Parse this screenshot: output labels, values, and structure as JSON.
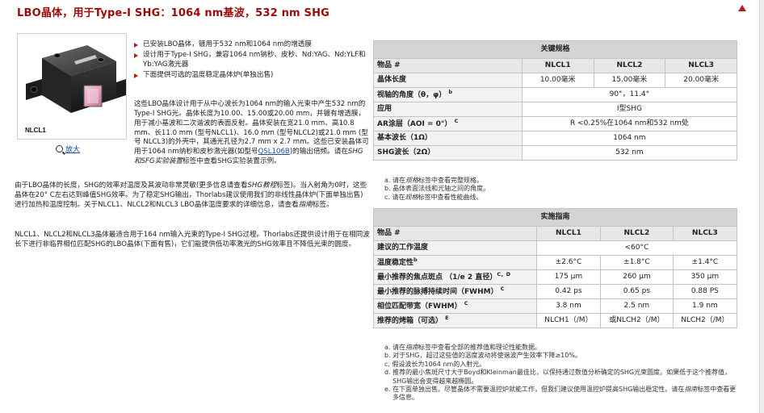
{
  "page": {
    "title": "LBO晶体，用于Type-I SHG：1064 nm基波，532 nm SHG"
  },
  "product_image": {
    "label": "NLCL1",
    "zoom_link": "放大"
  },
  "bullets": [
    "已安装LBO晶体，镀用于532 nm和1064 nm的增透膜",
    "设计用于Type-I SHG，兼容1064 nm钠秒、皮秒、Nd:YAG、Nd:YLF和Yb:YAG激光器",
    "下面提供可选的温度稳定晶体炉(单独出售)"
  ],
  "paragraphs": {
    "p1": {
      "before": "这些LBO晶体设计用于从中心波长为1064 nm的输入光束中产生532 nm的Type-I SHG光。晶体长度为10.00、15.00或20.00 mm，并镀有增透膜，用于减小基波和二次谐波的表面反射。晶体安装在宽21.0 mm、高10.8 mm、长11.0 mm (型号NLCL1)、16.0 mm (型号NLCL2)或21.0 mm (型号 NLCL3)的外壳中，其通光孔径为2.7 mm x 2.7 mm。这些已安装晶体可用于1064 nm纳秒和皮秒激光器(如型号",
      "link": "QSL106B",
      "mid": ")的输出倍频。请在",
      "italic": "SHG和SFG实验装置",
      "after": "标签中查看SHG实验装置示例。"
    },
    "p2": {
      "before": "由于LBO晶体的长度，SHG的效率对温度及其波动非常灵敏(更多信息请查看",
      "italic": "SHG教程",
      "mid": "标签)。当入射角为0时，这些晶体在20° C左右达到峰值SHG效率。为了稳定SHG输出，Thorlabs建议使用我们的非线性晶体炉(下面单独出售)进行加热和温度控制。关于NLCL1、NLCL2和NLCL3 LBO晶体温度要求的详细信息，请查看",
      "italic2": "指南",
      "after": "标签。"
    },
    "p3": {
      "text": "NLCL1、NLCL2和NLCL3晶体最适合用于164 nm输入光束的Type-I SHG过程。Thorlabs还提供设计用于在相同波长下进行非临界相位匹配SHG的LBO晶体(下面有售)，它们能提供低功率激光的SHG效率且不降低光束的圆度。"
    }
  },
  "key_specs": {
    "section_title": "关键规格",
    "columns": [
      "物品 #",
      "NLCL1",
      "NLCL2",
      "NLCL3"
    ],
    "rows": [
      {
        "label": "晶体长度",
        "sup": "",
        "cells": [
          "10.00毫米",
          "15.00毫米",
          "20.00毫米"
        ]
      },
      {
        "label": "视轴的角度（θ，φ）",
        "sup": "b",
        "span": "90°，11.4°"
      },
      {
        "label": "应用",
        "sup": "",
        "span": "I型SHG"
      },
      {
        "label": "AR涂层（AOI = 0°）",
        "sup": "C",
        "span": "R <0.25%在1064 nm和532 nm处"
      },
      {
        "label": "基本波长（1Ω）",
        "sup": "",
        "span": "1064 nm"
      },
      {
        "label": "SHG波长（2Ω）",
        "sup": "",
        "span": "532 nm"
      }
    ],
    "notes": [
      {
        "mark": "a.",
        "parts": [
          "请在",
          "规格",
          "标签中查看完整规格。"
        ]
      },
      {
        "mark": "b.",
        "parts": [
          "晶体表面法线和光轴之间的角度。",
          "",
          ""
        ]
      },
      {
        "mark": "c.",
        "parts": [
          "请在",
          "规格",
          "标签中查看性能曲线。"
        ]
      }
    ]
  },
  "operating_specs": {
    "section_title": "实施指南",
    "columns": [
      "物品 #",
      "NLCL1",
      "NLCL2",
      "NLCL3"
    ],
    "rows": [
      {
        "label": "建议的工作温度",
        "sup": "",
        "span": "<60°C"
      },
      {
        "label": "温度稳定性",
        "sup": "b",
        "cells": [
          "±2.6°C",
          "±1.8°C",
          "±1.4°C"
        ]
      },
      {
        "label": "最小推荐的焦点斑点 （1/e 2 直径）",
        "sup": "C，D",
        "cells": [
          "175 μm",
          "260 μm",
          "350 μm"
        ]
      },
      {
        "label": "最小推荐的脉搏持续时间（FWHM）",
        "sup": "C",
        "cells": [
          "0.42 ps",
          "0.65 ps",
          "0.88 PS"
        ]
      },
      {
        "label": "相位匹配带宽（FWHM）",
        "sup": "C",
        "cells": [
          "3.8 nm",
          "2.5 nm",
          "1.9 nm"
        ]
      },
      {
        "label": "推荐的烤箱（可选）",
        "sup": "E",
        "cells": [
          "NLCH1（/M）",
          "或NLCH2（/M）",
          "NLCH2（/M）"
        ]
      }
    ],
    "notes": [
      {
        "mark": "a.",
        "parts": [
          "请在",
          "指南",
          "标签中查看全部的推荐值和理论性能数据。"
        ]
      },
      {
        "mark": "b.",
        "parts": [
          "对于SHG，超过这些值的温度波动将使谐波产生效率下降≥10%。",
          "",
          ""
        ]
      },
      {
        "mark": "c.",
        "parts": [
          "假设波长为1064 nm的入射光。",
          "",
          ""
        ]
      },
      {
        "mark": "d.",
        "parts": [
          "推荐的最小焦斑尺寸大于Boyd和Kleinman最佳比，以保持通过数值分析确定的SHG光束圆度。如果低于这个推荐值，SHG输出会变得越来越椭圆。",
          "",
          ""
        ]
      },
      {
        "mark": "e.",
        "parts": [
          "在下面单独出售。尽管晶体不需要温控炉就能工作，但我们建议使用温控炉提高SHG输出稳定性。请在",
          "指南",
          "标签中查看更多信息。"
        ]
      }
    ]
  }
}
